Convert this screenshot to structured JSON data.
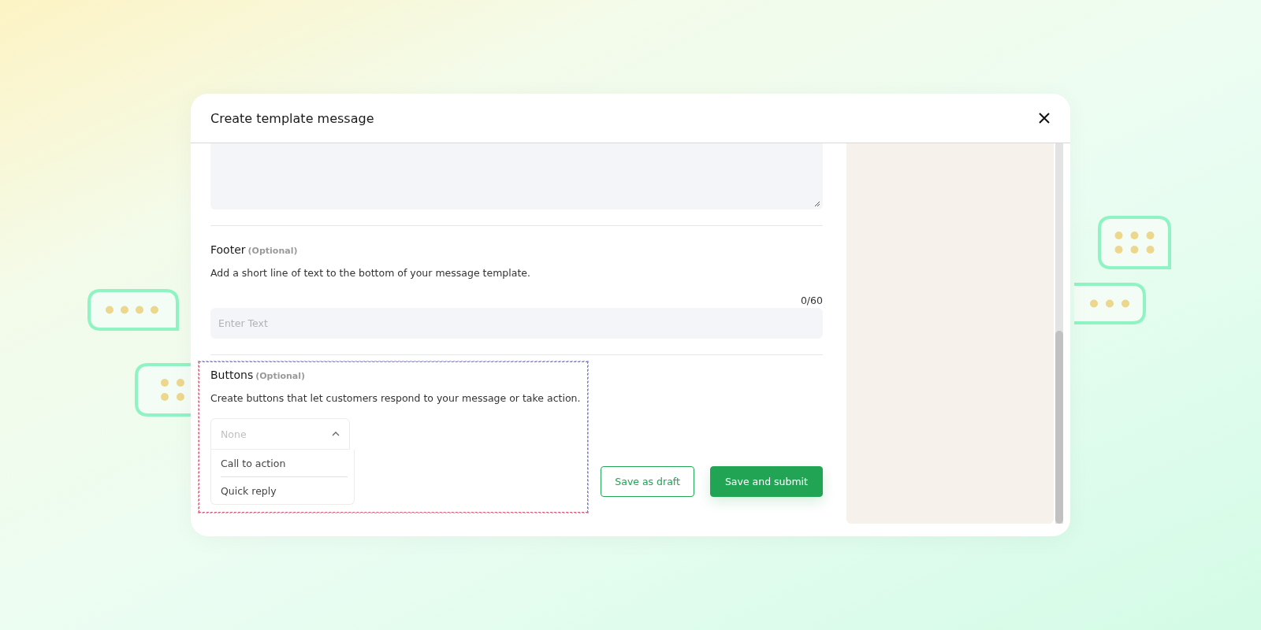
{
  "modal": {
    "title": "Create template message"
  },
  "footer": {
    "title": "Footer",
    "optional": "(Optional)",
    "description": "Add a short line of text to the bottom of your message template.",
    "counter": "0/60",
    "placeholder": "Enter Text"
  },
  "buttons": {
    "title": "Buttons",
    "optional": "(Optional)",
    "description": "Create buttons that let customers respond to your message or take action.",
    "select": {
      "placeholder": "None",
      "expanded": true,
      "options": [
        {
          "label": "Call to action"
        },
        {
          "label": "Quick reply"
        }
      ]
    }
  },
  "actions": [
    {
      "label": "Save as draft",
      "kind": "secondary"
    },
    {
      "label": "Save and submit",
      "kind": "primary"
    }
  ]
}
